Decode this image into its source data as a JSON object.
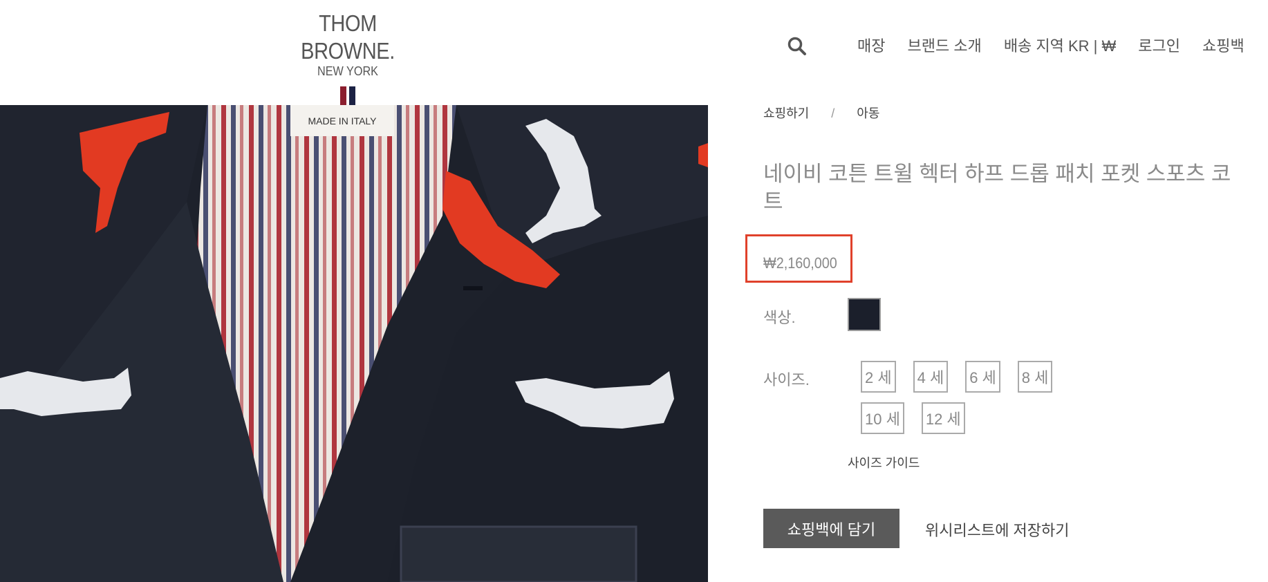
{
  "header": {
    "brand": "THOM BROWNE.",
    "city": "NEW YORK",
    "search_icon": "search-icon",
    "nav": [
      "매장",
      "브랜드 소개",
      "배송 지역 KR | ₩",
      "로그인",
      "쇼핑백"
    ]
  },
  "product_image": {
    "label_text": "MADE IN ITALY"
  },
  "breadcrumb": {
    "shop": "쇼핑하기",
    "separator": "/",
    "category": "아동"
  },
  "product": {
    "title": "네이비 코튼 트윌 헥터 하프 드롭 패치 포켓 스포츠 코트",
    "price": "₩2,160,000",
    "color_label": "색상.",
    "color_swatch": "#1b1f2b",
    "size_label": "사이즈.",
    "sizes": [
      "2 세",
      "4 세",
      "6 세",
      "8 세",
      "10 세",
      "12 세"
    ],
    "size_guide": "사이즈 가이드",
    "add_to_bag": "쇼핑백에 담기",
    "wishlist": "위시리스트에 저장하기"
  },
  "colors": {
    "highlight": "#e0412b",
    "flag_red": "#8b1e2e",
    "flag_navy": "#1c2244",
    "button": "#5a5a5a"
  }
}
